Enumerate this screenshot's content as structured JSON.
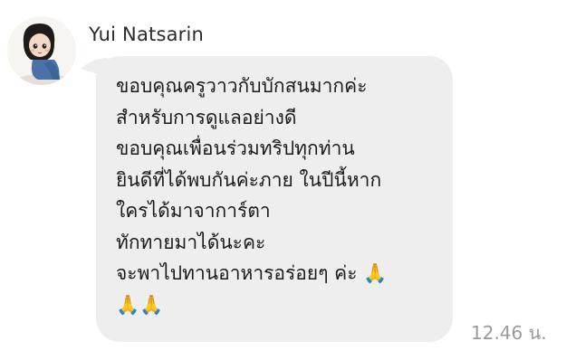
{
  "chat": {
    "sender_name": "Yui Natsarin",
    "message": "ขอบคุณครูวาวกับบักสนมากค่ะ\nสำหรับการดูแลอย่างดี\nขอบคุณเพื่อนร่วมทริปทุกท่าน\nยินดีที่ได้พบกันค่ะภาย ในปีนี้หาก\n ใครได้มาจาการ์ตา\nทักทายมาได้นะคะ\nจะพาไปทานอาหารอร่อยๆ ค่ะ 🙏\n🙏🙏",
    "timestamp": "12.46 น."
  },
  "colors": {
    "bubble": "#eeeeef",
    "name_text": "#2b2b2b",
    "message_text": "#1a1a1a",
    "timestamp_text": "#9a9a9a"
  },
  "icons": {
    "avatar": "girl-avatar-icon"
  }
}
